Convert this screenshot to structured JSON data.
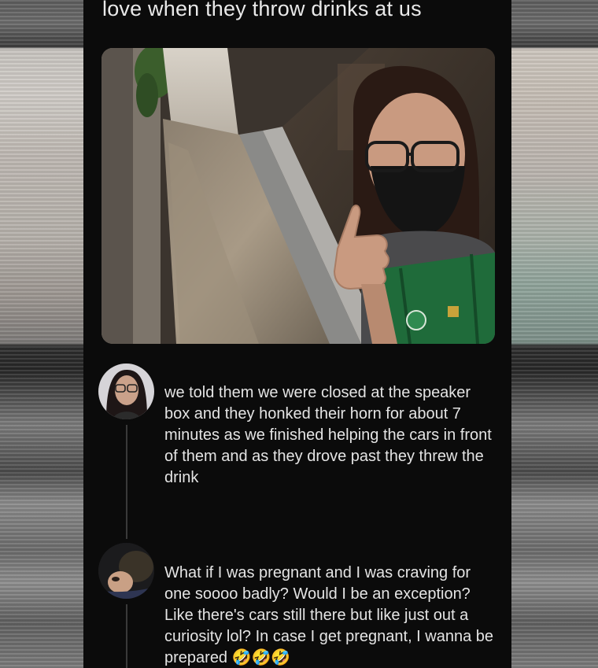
{
  "post": {
    "caption": "love when they throw drinks at us",
    "photo_alt": "selfie photo"
  },
  "replies": [
    {
      "text": "we told them we were closed at the speaker box and they honked their horn for about 7 minutes as we finished helping the cars in front of them and as they drove past they threw the drink",
      "emoji": ""
    },
    {
      "text": "What if I was pregnant and I was craving for one soooo badly? Would I be an exception? Like there's cars still there but like just out a curiosity lol? In case I get pregnant, I wanna be prepared",
      "emoji": "🤣🤣🤣"
    }
  ],
  "icons": {
    "avatar_1": "user-avatar",
    "avatar_2": "user-avatar",
    "emoji": "rolling-on-floor-laughing-emoji"
  },
  "colors": {
    "panel_bg": "#0b0b0b",
    "text": "#e4e4e4",
    "thread_line": "#3a3a3a",
    "apron_green": "#1f6b3a"
  }
}
